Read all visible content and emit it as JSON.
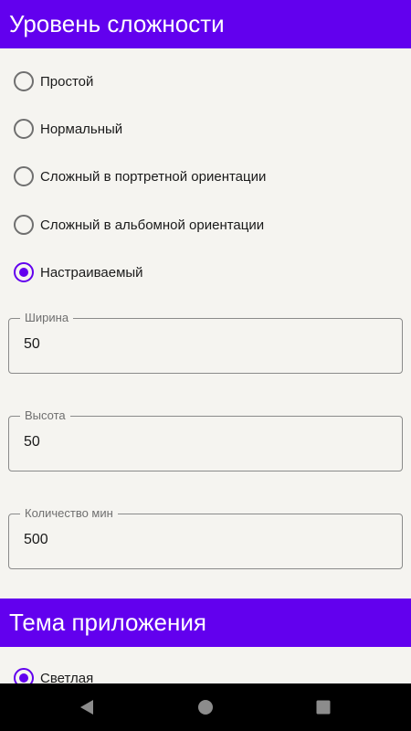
{
  "difficulty": {
    "title": "Уровень сложности",
    "options": [
      {
        "label": "Простой",
        "checked": false
      },
      {
        "label": "Нормальный",
        "checked": false
      },
      {
        "label": "Сложный в портретной ориентации",
        "checked": false
      },
      {
        "label": "Сложный в альбомной ориентации",
        "checked": false
      },
      {
        "label": "Настраиваемый",
        "checked": true
      }
    ],
    "fields": {
      "width": {
        "label": "Ширина",
        "value": "50"
      },
      "height": {
        "label": "Высота",
        "value": "50"
      },
      "mines": {
        "label": "Количество мин",
        "value": "500"
      }
    }
  },
  "theme": {
    "title": "Тема приложения",
    "options": [
      {
        "label": "Светлая",
        "checked": true
      }
    ]
  },
  "navbar": {
    "back_icon": "back-triangle-icon",
    "home_icon": "home-circle-icon",
    "recents_icon": "recents-square-icon"
  },
  "colors": {
    "accent": "#6200ee",
    "background": "#f5f4f0",
    "navbar": "#000000"
  }
}
